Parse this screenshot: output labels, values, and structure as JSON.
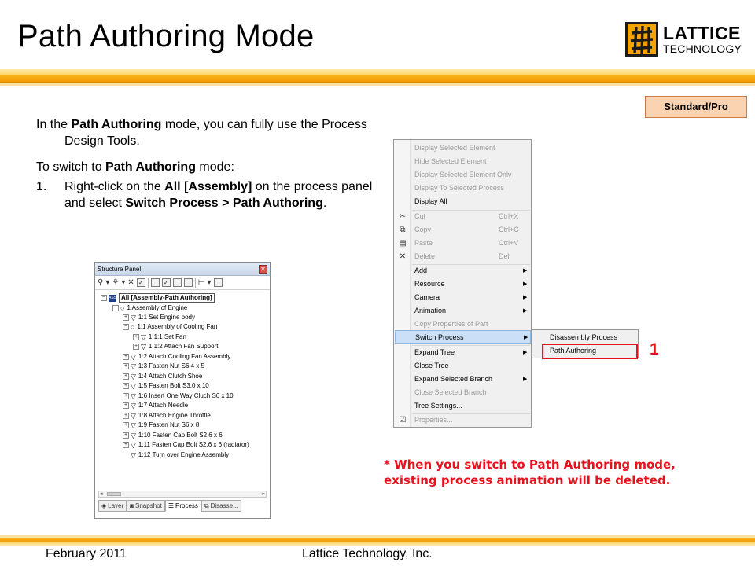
{
  "slide": {
    "title": "Path Authoring Mode",
    "edition_badge": "Standard/Pro"
  },
  "logo": {
    "line1": "LATTICE",
    "line2": "TECHNOLOGY"
  },
  "instructions": {
    "para1": {
      "t1": "In the ",
      "b1": "Path Authoring",
      "t2": " mode, you can fully use the Process Design Tools."
    },
    "para2": {
      "t1": "To switch to ",
      "b1": "Path Authoring",
      "t2": " mode:"
    },
    "step1": {
      "num": "1.",
      "t1": "Right-click on the ",
      "b1": "All [Assembly]",
      "t2": " on the process panel and select ",
      "b2": "Switch Process > Path Authoring",
      "t3": "."
    }
  },
  "structure_panel": {
    "title": "Structure Panel",
    "close_glyph": "✕",
    "root_icon_text": "ASSY",
    "tree": [
      {
        "label": "All [Assembly-Path Authoring]"
      },
      {
        "label": "1 Assembly of Engine"
      },
      {
        "label": "1:1 Set Engine body"
      },
      {
        "label": "1:1 Assembly of Cooling Fan"
      },
      {
        "label": "1:1:1 Set Fan"
      },
      {
        "label": "1:1:2 Attach Fan Support"
      },
      {
        "label": "1:2 Attach Cooling Fan Assembly"
      },
      {
        "label": "1:3 Fasten Nut S6.4 x 5"
      },
      {
        "label": "1:4 Attach Clutch Shoe"
      },
      {
        "label": "1:5 Fasten Bolt S3.0 x 10"
      },
      {
        "label": "1:6 Insert One Way Cluch S6 x 10"
      },
      {
        "label": "1:7 Attach Needle"
      },
      {
        "label": "1:8 Attach Engine Throttle"
      },
      {
        "label": "1:9 Fasten Nut S6 x 8"
      },
      {
        "label": "1:10 Fasten Cap Bolt S2.6 x 6"
      },
      {
        "label": "1:11 Fasten Cap Bolt S2.6 x 6 (radiator)"
      },
      {
        "label": "1:12 Turn over Engine Assembly"
      }
    ],
    "tabs": [
      {
        "label": "Layer"
      },
      {
        "label": "Snapshot"
      },
      {
        "label": "Process"
      },
      {
        "label": "Disasse..."
      }
    ]
  },
  "context_menu": {
    "items": [
      {
        "label": "Display Selected Element"
      },
      {
        "label": "Hide Selected Element"
      },
      {
        "label": "Display Selected Element Only"
      },
      {
        "label": "Display To Selected Process"
      },
      {
        "label": "Display All"
      },
      {
        "label": "Cut",
        "shortcut": "Ctrl+X"
      },
      {
        "label": "Copy",
        "shortcut": "Ctrl+C"
      },
      {
        "label": "Paste",
        "shortcut": "Ctrl+V"
      },
      {
        "label": "Delete",
        "shortcut": "Del"
      },
      {
        "label": "Add"
      },
      {
        "label": "Resource"
      },
      {
        "label": "Camera"
      },
      {
        "label": "Animation"
      },
      {
        "label": "Copy Properties of Part"
      },
      {
        "label": "Switch Process"
      },
      {
        "label": "Expand Tree"
      },
      {
        "label": "Close Tree"
      },
      {
        "label": "Expand Selected Branch"
      },
      {
        "label": "Close Selected Branch"
      },
      {
        "label": "Tree Settings..."
      },
      {
        "label": "Properties..."
      }
    ],
    "submenu": [
      {
        "label": "Disassembly Process"
      },
      {
        "label": "Path Authoring"
      }
    ],
    "step_number": "1"
  },
  "warning": "* When you switch to Path Authoring mode, existing process animation will be deleted.",
  "footer": {
    "date": "February 2011",
    "company": "Lattice Technology, Inc."
  },
  "colors": {
    "accent_red": "#e8121e",
    "band_orange": "#f49a06",
    "badge_fill": "#fbd3b1",
    "menu_highlight": "#cbe0f6"
  }
}
